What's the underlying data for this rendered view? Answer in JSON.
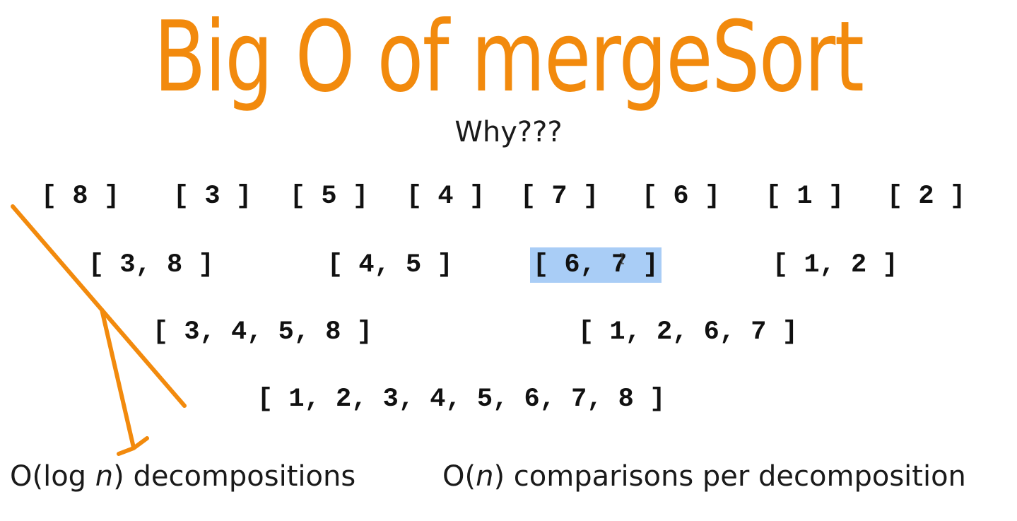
{
  "slide": {
    "title": "Big O of mergeSort",
    "subtitle": "Why???",
    "levels": [
      [
        "[ 8 ]",
        "[ 3 ]",
        "[ 5 ]",
        "[ 4 ]",
        "[ 7 ]",
        "[ 6 ]",
        "[ 1 ]",
        "[ 2 ]"
      ],
      [
        "[ 3, 8 ]",
        "[ 4, 5 ]",
        "[ 6, 7 ]",
        "[ 1, 2 ]"
      ],
      [
        "[ 3, 4, 5, 8 ]",
        "[ 1, 2, 6, 7 ]"
      ],
      [
        "[ 1, 2, 3, 4, 5, 6, 7, 8 ]"
      ]
    ],
    "highlighted_array": "[ 6, 7 ]",
    "bottom_left": {
      "prefix": "O(log ",
      "var": "n",
      "suffix": ") decompositions"
    },
    "bottom_right": {
      "prefix": "O(",
      "var": "n",
      "suffix": ") comparisons per decomposition"
    }
  },
  "colors": {
    "title": "#f28a0d",
    "arrow": "#f28a0d",
    "highlight": "#a9cdf6",
    "text": "#111111"
  },
  "icons": {
    "arrow": "orange-diagonal-arrow-icon",
    "cursor": "text-cursor-icon"
  }
}
